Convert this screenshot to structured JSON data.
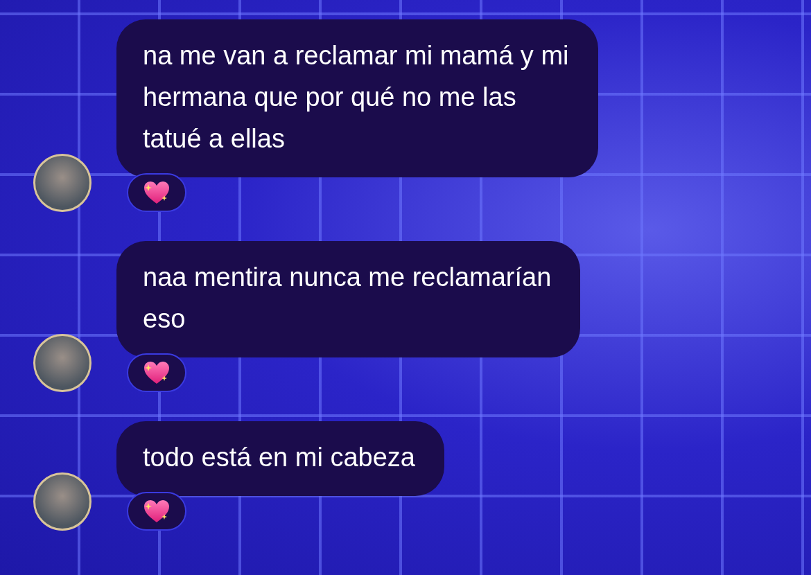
{
  "messages": [
    {
      "text": "na me van a reclamar mi mamá y mi\nhermana que por qué no me las\ntatué a ellas"
    },
    {
      "text": "naa mentira nunca me reclamarían\neso"
    },
    {
      "text": "todo está en mi cabeza"
    }
  ]
}
